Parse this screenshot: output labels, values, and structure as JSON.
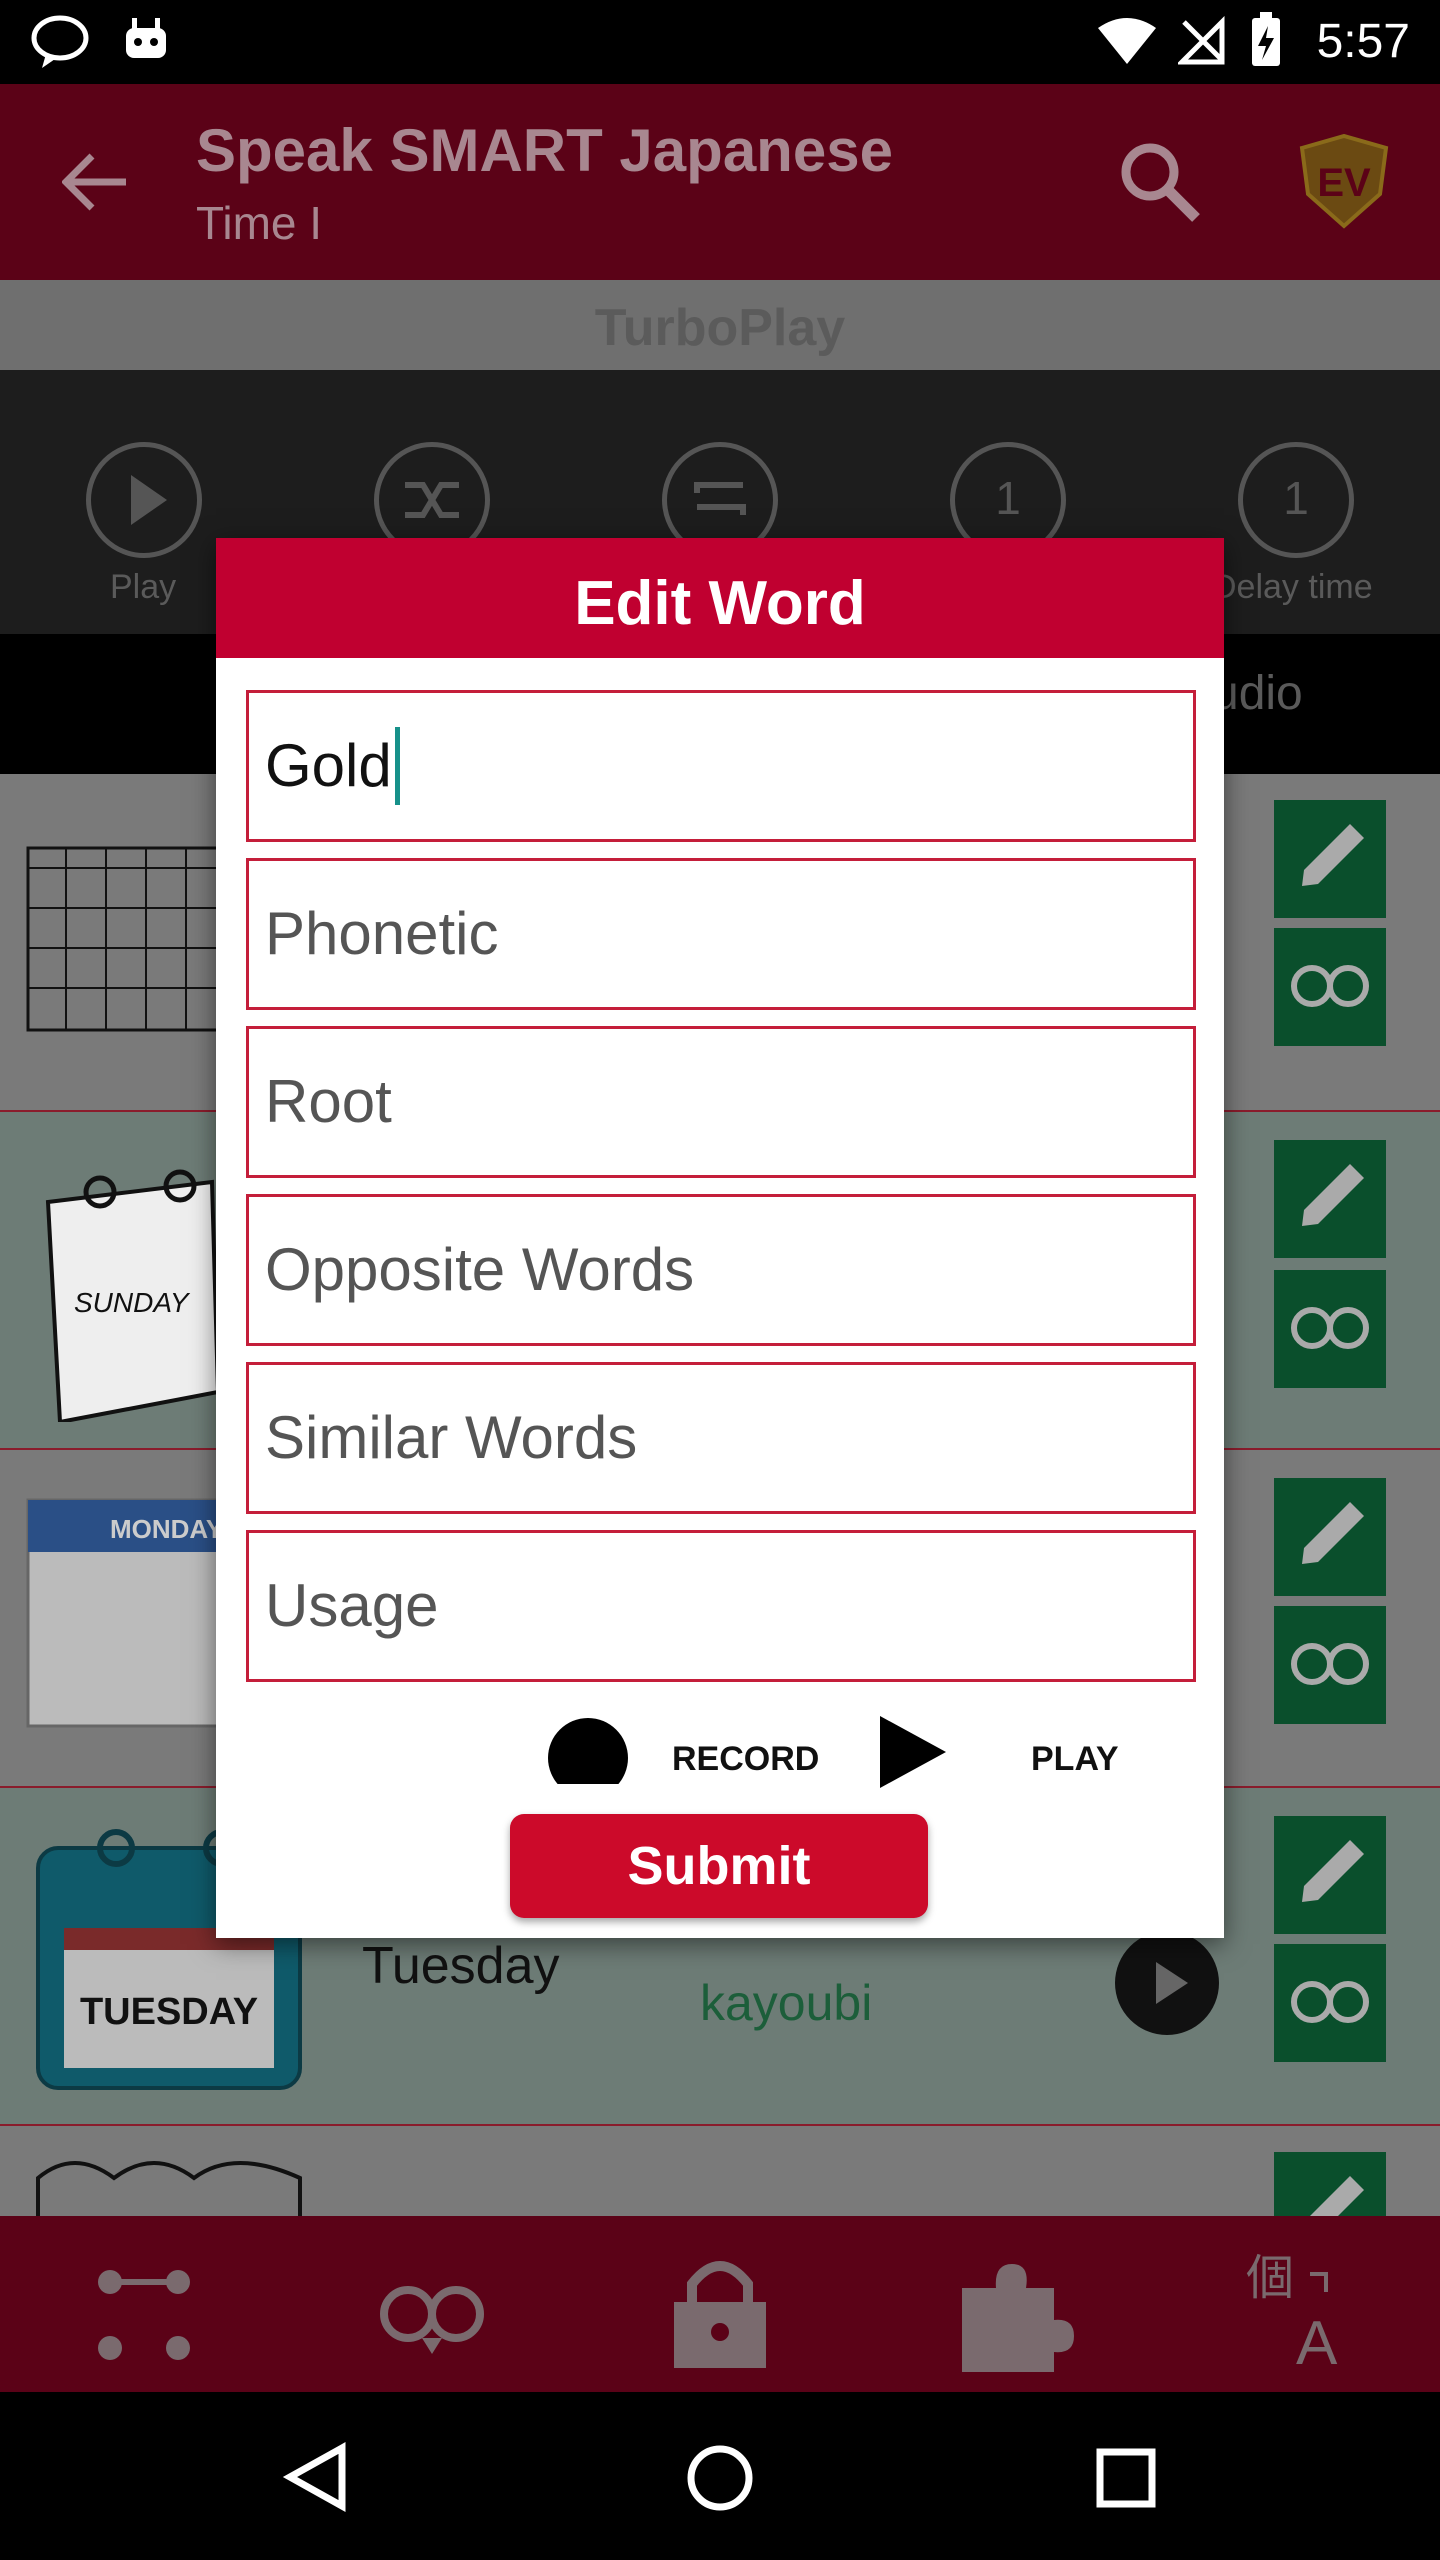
{
  "status_bar": {
    "time": "5:57"
  },
  "app_bar": {
    "title": "Speak SMART Japanese",
    "subtitle": "Time I"
  },
  "turboplay": {
    "label": "TurboPlay",
    "controls": [
      {
        "label": "Play"
      },
      {
        "label": ""
      },
      {
        "label": ""
      },
      {
        "value": "1"
      },
      {
        "value": "1",
        "label": "Delay time"
      }
    ]
  },
  "tabs": {
    "right_label": "udio"
  },
  "list": {
    "rows": [
      {
        "image_text": "SUNDAY"
      },
      {
        "image_text": "MONDAY"
      },
      {
        "image_text": "TUESDAY",
        "english": "Tuesday",
        "romaji": "kayoubi"
      }
    ]
  },
  "dialog": {
    "title": "Edit Word",
    "fields": {
      "word": {
        "value": "Gold"
      },
      "phonetic": {
        "placeholder": "Phonetic"
      },
      "root": {
        "placeholder": "Root"
      },
      "opposite": {
        "placeholder": "Opposite Words"
      },
      "similar": {
        "placeholder": "Similar Words"
      },
      "usage": {
        "placeholder": "Usage"
      }
    },
    "record_label": "RECORD",
    "play_label": "PLAY",
    "submit_label": "Submit"
  },
  "colors": {
    "accent": "#c00030",
    "app_bar": "#5b0217",
    "green_button": "#0a4f2c"
  },
  "icons": [
    "back-arrow-icon",
    "search-icon",
    "ev-logo-icon",
    "edit-pencil-icon",
    "owl-icon",
    "lock-icon",
    "puzzle-icon",
    "translate-icon"
  ]
}
